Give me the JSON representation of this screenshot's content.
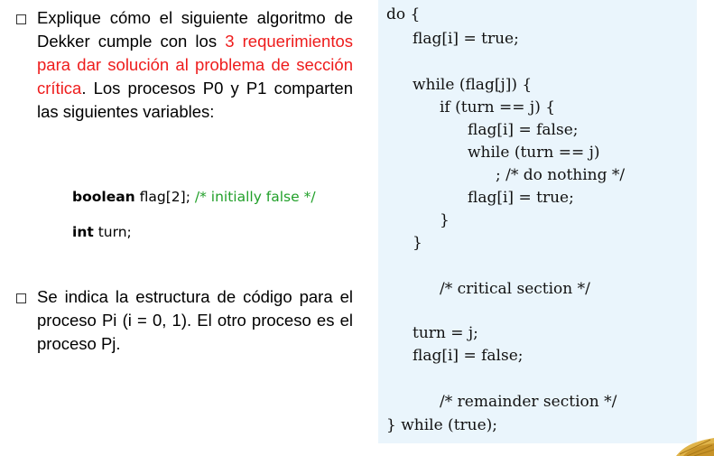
{
  "para1": {
    "bullet": "hollow-square-bullet",
    "text_before": "Explique cómo el siguiente algoritmo de Dekker cumple con los ",
    "text_red": "3 requerimientos para dar solución al problema de sección crítica",
    "text_after": ". Los procesos P0 y P1 comparten las siguientes variables:"
  },
  "declarations": {
    "flag": {
      "keyword": "boolean",
      "rest": " flag[2]; ",
      "comment": "/* initially false */"
    },
    "turn": {
      "keyword": "int",
      "rest": " turn;"
    }
  },
  "para2": {
    "bullet": "hollow-square-bullet",
    "text": "Se indica la estructura de código para el proceso Pi (i = 0, 1). El otro proceso es el proceso Pj."
  },
  "code": {
    "lines": [
      "do {",
      "flag[i] = true;",
      "while (flag[j]) {",
      "if (turn == j) {",
      "flag[i] = false;",
      "while (turn == j)",
      "; /* do nothing */",
      "flag[i] = true;",
      "}",
      "}",
      "/* critical section */",
      "turn = j;",
      "flag[i] = false;",
      "/* remainder section */",
      "} while (true);"
    ]
  },
  "colors": {
    "accent_red": "#ee1c1c",
    "comment_green": "#22a02a",
    "code_bg": "#eaf5fc"
  }
}
